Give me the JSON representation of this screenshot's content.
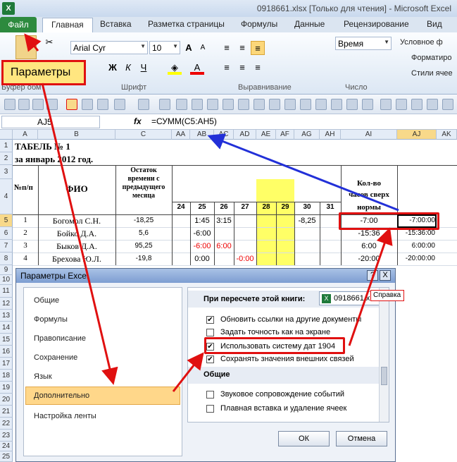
{
  "window": {
    "app_icon": "X",
    "title": "0918661.xlsx  [Только для чтения]  -  Microsoft Excel"
  },
  "ribbon_tabs": [
    "Файл",
    "Главная",
    "Вставка",
    "Разметка страницы",
    "Формулы",
    "Данные",
    "Рецензирование",
    "Вид"
  ],
  "ribbon": {
    "font_name": "Arial Cyr",
    "font_size": "10",
    "number_format": "Время",
    "group_font": "Шрифт",
    "group_align": "Выравнивание",
    "group_number": "Число",
    "group_clipboard": "Буфер обм",
    "cond_format": "Условное ф",
    "format_table": "Форматиро",
    "cell_styles": "Стили ячее"
  },
  "callout": {
    "label": "Параметры"
  },
  "formula_bar": {
    "name_box": "AJ5",
    "fx": "fx",
    "formula": "=СУММ(C5:AH5)"
  },
  "columns": [
    "A",
    "B",
    "C",
    "AA",
    "AB",
    "AC",
    "AD",
    "AE",
    "AF",
    "AG",
    "AH",
    "AI",
    "AJ",
    "AK"
  ],
  "sheet": {
    "title1": "ТАБЕЛЬ № 1",
    "title2": "за январь 2012 год.",
    "h_num": "№п/п",
    "h_fio": "ФИО",
    "h_rest": [
      "Остаток",
      "времени с",
      "предыдущего",
      "месяца"
    ],
    "h_days": [
      "24",
      "25",
      "26",
      "27",
      "28",
      "29",
      "30",
      "31"
    ],
    "h_over": [
      "Кол-во",
      "часов сверх",
      "нормы"
    ],
    "rows": [
      {
        "n": "1",
        "fio": "Богомол С.Н.",
        "rest": "-18,25",
        "d25": "1:45",
        "d26": "3:15",
        "d30": "-8,25",
        "ai": "-7:00",
        "aj": "-7:00:00"
      },
      {
        "n": "2",
        "fio": "Бойко Д.А.",
        "rest": "5,6",
        "d25": "-6:00",
        "ai": "-15:36",
        "aj": "-15:36:00"
      },
      {
        "n": "3",
        "fio": "Быков Д.А.",
        "rest": "95,25",
        "d25": "-6:00",
        "d26": "6:00",
        "ai": "6:00",
        "aj": "6:00:00"
      },
      {
        "n": "4",
        "fio": "Брехова Ю.Л.",
        "rest": "-19,8",
        "d25": "0:00",
        "d27": "-0:00",
        "ai": "-20:00",
        "aj": "-20:00:00"
      }
    ],
    "row_numbers": [
      "1",
      "2",
      "3",
      "4",
      "5",
      "6",
      "7",
      "8",
      "9",
      "10",
      "11",
      "12",
      "13",
      "14",
      "15",
      "16",
      "17",
      "18",
      "19",
      "20",
      "21",
      "22",
      "23",
      "24",
      "25",
      "26"
    ]
  },
  "dialog": {
    "title": "Параметры Excel",
    "help_btn": "?",
    "close_btn": "X",
    "nav": [
      "Общие",
      "Формулы",
      "Правописание",
      "Сохранение",
      "Язык",
      "Дополнительно",
      "Настройка ленты"
    ],
    "section_recalc": "При пересчете этой книги:",
    "workbook": "0918661.xlsx",
    "tooltip": "Справка",
    "options": [
      {
        "label": "Обновить ссылки на другие документы",
        "checked": true
      },
      {
        "label": "Задать точность как на экране",
        "checked": false
      },
      {
        "label": "Использовать систему дат 1904",
        "checked": true
      },
      {
        "label": "Сохранять значения внешних связей",
        "checked": true
      }
    ],
    "section_general": "Общие",
    "options2": [
      {
        "label": "Звуковое сопровождение событий",
        "checked": false
      },
      {
        "label": "Плавная вставка и удаление ячеек",
        "checked": false
      }
    ],
    "ok": "ОК",
    "cancel": "Отмена"
  }
}
